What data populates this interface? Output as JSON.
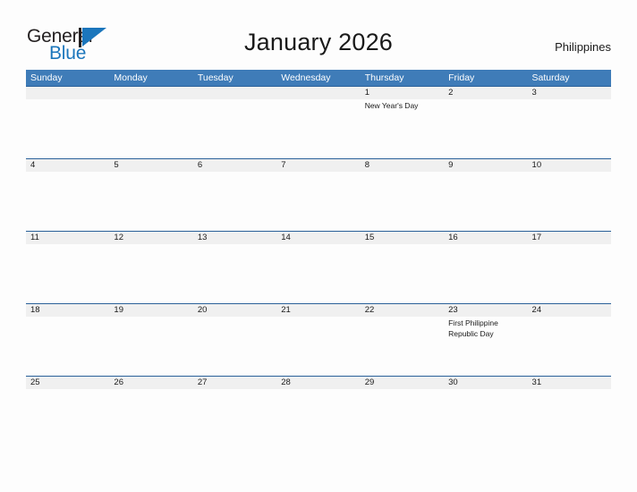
{
  "brand": {
    "name_part1": "General",
    "name_part2": "Blue",
    "mark_icon": "flag-triangle-icon",
    "primary_color": "#1b76bc",
    "text_color": "#231f20"
  },
  "header": {
    "title": "January 2026",
    "country": "Philippines"
  },
  "calendar": {
    "header_bg_color": "#3f7cb8",
    "daynum_band_color": "#f0f0f0",
    "row_divider_color": "#2a6099",
    "weekdays": [
      "Sunday",
      "Monday",
      "Tuesday",
      "Wednesday",
      "Thursday",
      "Friday",
      "Saturday"
    ],
    "weeks": [
      {
        "days": [
          {
            "num": "",
            "event": ""
          },
          {
            "num": "",
            "event": ""
          },
          {
            "num": "",
            "event": ""
          },
          {
            "num": "",
            "event": ""
          },
          {
            "num": "1",
            "event": "New Year's Day"
          },
          {
            "num": "2",
            "event": ""
          },
          {
            "num": "3",
            "event": ""
          }
        ]
      },
      {
        "days": [
          {
            "num": "4",
            "event": ""
          },
          {
            "num": "5",
            "event": ""
          },
          {
            "num": "6",
            "event": ""
          },
          {
            "num": "7",
            "event": ""
          },
          {
            "num": "8",
            "event": ""
          },
          {
            "num": "9",
            "event": ""
          },
          {
            "num": "10",
            "event": ""
          }
        ]
      },
      {
        "days": [
          {
            "num": "11",
            "event": ""
          },
          {
            "num": "12",
            "event": ""
          },
          {
            "num": "13",
            "event": ""
          },
          {
            "num": "14",
            "event": ""
          },
          {
            "num": "15",
            "event": ""
          },
          {
            "num": "16",
            "event": ""
          },
          {
            "num": "17",
            "event": ""
          }
        ]
      },
      {
        "days": [
          {
            "num": "18",
            "event": ""
          },
          {
            "num": "19",
            "event": ""
          },
          {
            "num": "20",
            "event": ""
          },
          {
            "num": "21",
            "event": ""
          },
          {
            "num": "22",
            "event": ""
          },
          {
            "num": "23",
            "event": "First Philippine Republic Day"
          },
          {
            "num": "24",
            "event": ""
          }
        ]
      },
      {
        "days": [
          {
            "num": "25",
            "event": ""
          },
          {
            "num": "26",
            "event": ""
          },
          {
            "num": "27",
            "event": ""
          },
          {
            "num": "28",
            "event": ""
          },
          {
            "num": "29",
            "event": ""
          },
          {
            "num": "30",
            "event": ""
          },
          {
            "num": "31",
            "event": ""
          }
        ]
      }
    ]
  }
}
